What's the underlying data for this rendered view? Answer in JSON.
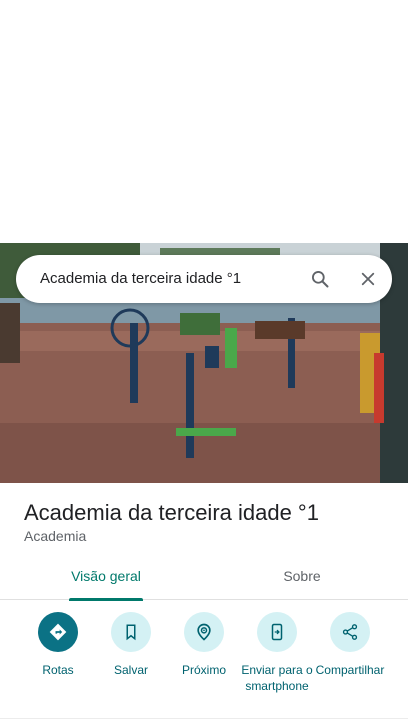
{
  "search": {
    "query": "Academia da terceira idade °1",
    "search_icon": "search-icon",
    "close_icon": "close-icon"
  },
  "place": {
    "title": "Academia da terceira idade °1",
    "category": "Academia",
    "photo_alt": "Outdoor gym equipment in a park"
  },
  "tabs": [
    {
      "label": "Visão geral",
      "active": true
    },
    {
      "label": "Sobre",
      "active": false
    }
  ],
  "actions": [
    {
      "label": "Rotas",
      "icon": "directions-icon"
    },
    {
      "label": "Salvar",
      "icon": "bookmark-icon"
    },
    {
      "label": "Próximo",
      "icon": "nearby-icon"
    },
    {
      "label": "Enviar para o smartphone",
      "icon": "send-to-phone-icon"
    },
    {
      "label": "Compartilhar",
      "icon": "share-icon"
    }
  ],
  "colors": {
    "accent": "#00796b",
    "action_bg": "#d4f1f4",
    "primary_action_bg": "#0b7285"
  }
}
